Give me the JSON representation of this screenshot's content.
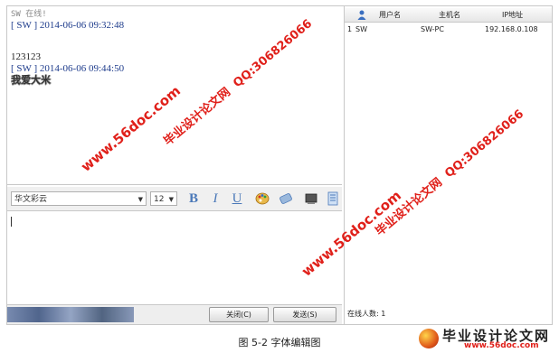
{
  "chat": {
    "system_line": "SW 在线!",
    "messages": [
      {
        "header": "[ SW ] 2014-06-06 09:32:48",
        "body": ""
      },
      {
        "header": "",
        "body": "123123"
      },
      {
        "header": "[ SW ] 2014-06-06 09:44:50",
        "body": "我爱大米"
      }
    ]
  },
  "toolbar": {
    "font_family": "华文彩云",
    "font_size": "12",
    "bold_label": "B",
    "italic_label": "I",
    "underline_label": "U"
  },
  "buttons": {
    "close_label": "关闭(C)",
    "send_label": "发送(S)"
  },
  "user_list": {
    "columns": [
      "用户名",
      "主机名",
      "IP地址"
    ],
    "rows": [
      {
        "index": "1",
        "username": "SW",
        "hostname": "SW-PC",
        "ip": "192.168.0.108"
      }
    ],
    "online_count_label": "在线人数: 1"
  },
  "watermarks": {
    "site_name": "毕业设计论文网",
    "site_url": "www.56doc.com",
    "qq": "QQ:306826066",
    "footer_name": "毕业设计论文网",
    "footer_url": "www.56doc.com"
  },
  "caption": "图 5-2 字体编辑图",
  "colors": {
    "header_text": "#1e3c8c",
    "watermark_red": "#e0201a",
    "toolbar_icon_blue": "#4a78b8"
  }
}
